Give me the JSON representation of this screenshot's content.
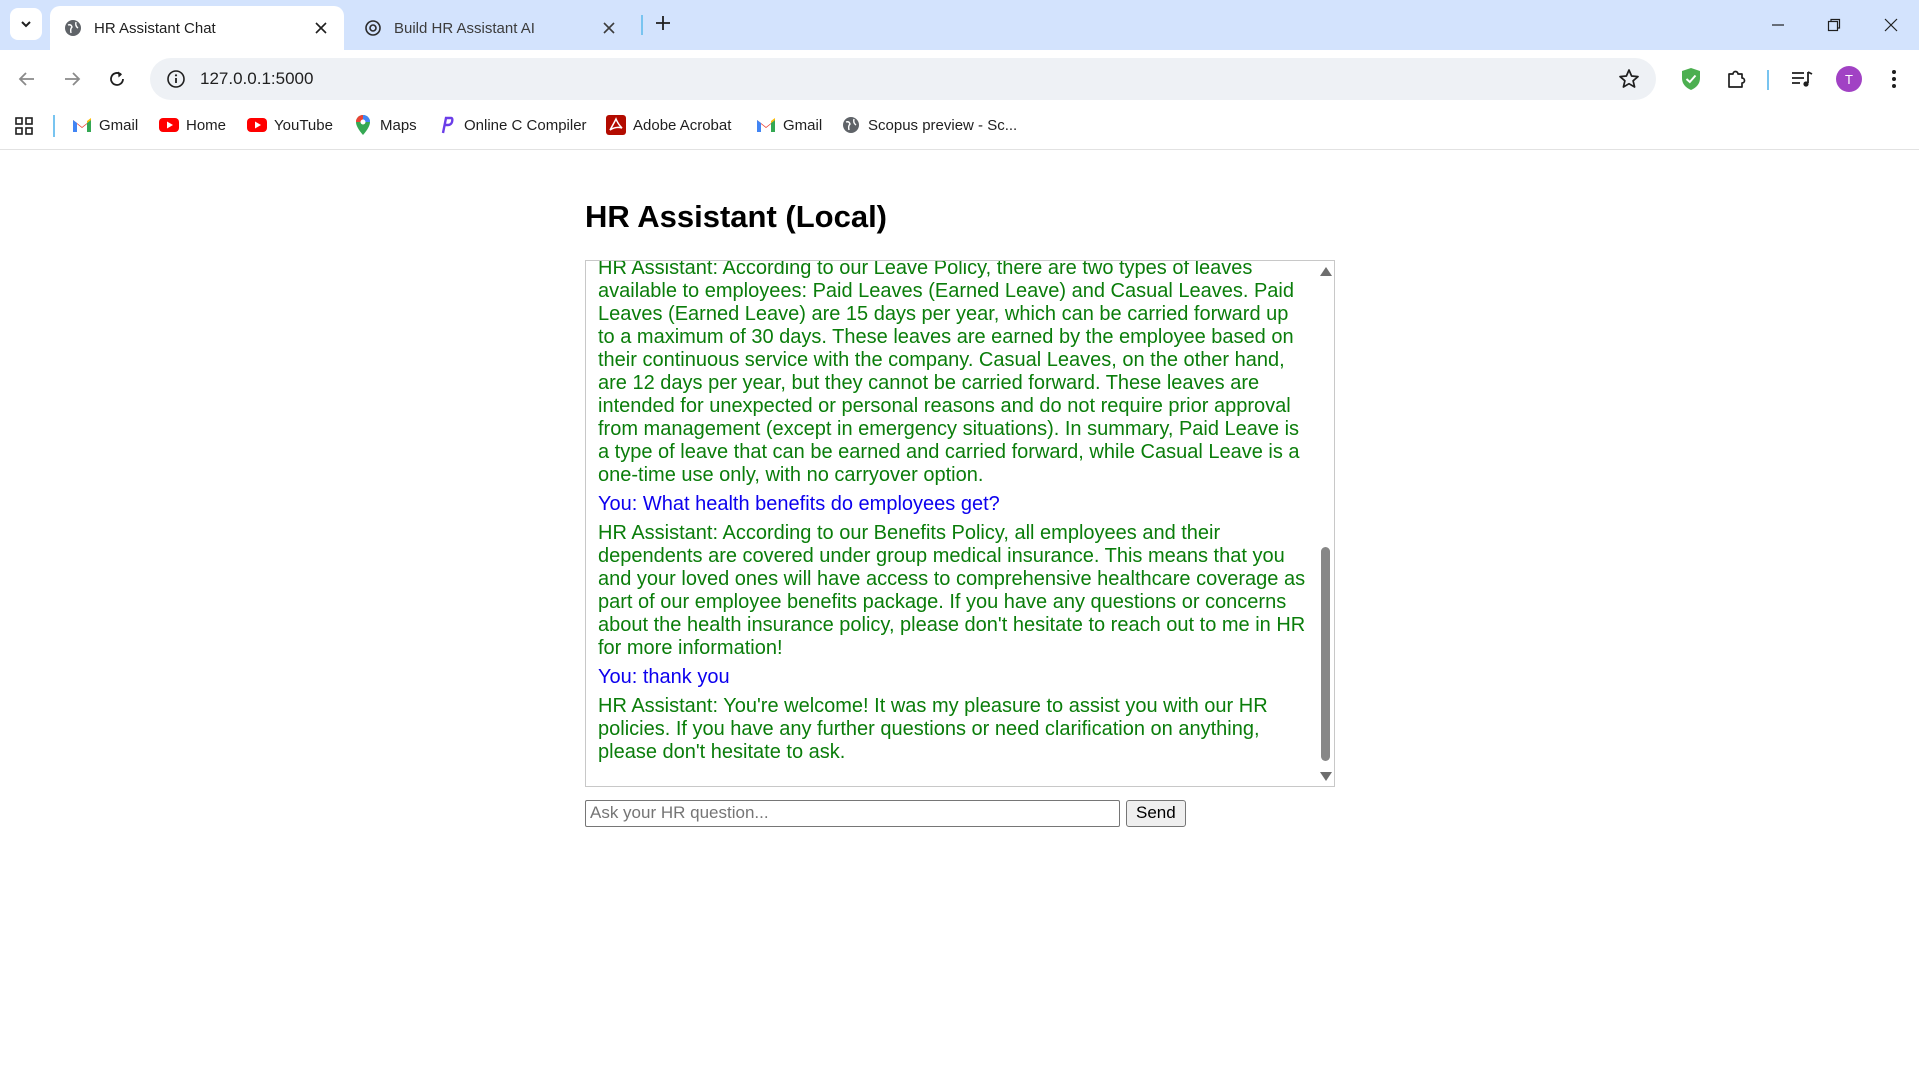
{
  "browser": {
    "tabs": [
      {
        "title": "HR Assistant Chat",
        "active": true
      },
      {
        "title": "Build HR Assistant AI",
        "active": false
      }
    ],
    "url": "127.0.0.1:5000",
    "profile_initial": "T",
    "bookmarks": [
      "Gmail",
      "Home",
      "YouTube",
      "Maps",
      "Online C Compiler",
      "Adobe Acrobat",
      "Gmail",
      "Scopus preview - Sc..."
    ]
  },
  "page": {
    "title": "HR Assistant (Local)",
    "messages": [
      {
        "role": "bot",
        "text": "HR Assistant: According to our Leave Policy, there are two types of leaves available to employees: Paid Leaves (Earned Leave) and Casual Leaves. Paid Leaves (Earned Leave) are 15 days per year, which can be carried forward up to a maximum of 30 days. These leaves are earned by the employee based on their continuous service with the company. Casual Leaves, on the other hand, are 12 days per year, but they cannot be carried forward. These leaves are intended for unexpected or personal reasons and do not require prior approval from management (except in emergency situations). In summary, Paid Leave is a type of leave that can be earned and carried forward, while Casual Leave is a one-time use only, with no carryover option."
      },
      {
        "role": "user",
        "text": "You: What health benefits do employees get?"
      },
      {
        "role": "bot",
        "text": "HR Assistant: According to our Benefits Policy, all employees and their dependents are covered under group medical insurance. This means that you and your loved ones will have access to comprehensive healthcare coverage as part of our employee benefits package. If you have any questions or concerns about the health insurance policy, please don't hesitate to reach out to me in HR for more information!"
      },
      {
        "role": "user",
        "text": "You: thank you"
      },
      {
        "role": "bot",
        "text": "HR Assistant: You're welcome! It was my pleasure to assist you with our HR policies. If you have any further questions or need clarification on anything, please don't hesitate to ask."
      }
    ],
    "input": {
      "placeholder": "Ask your HR question...",
      "value": ""
    },
    "send_label": "Send"
  },
  "colors": {
    "bot_text": "#0a7d0a",
    "user_text": "#0c00ee",
    "tabstrip": "#d3e3fd"
  }
}
